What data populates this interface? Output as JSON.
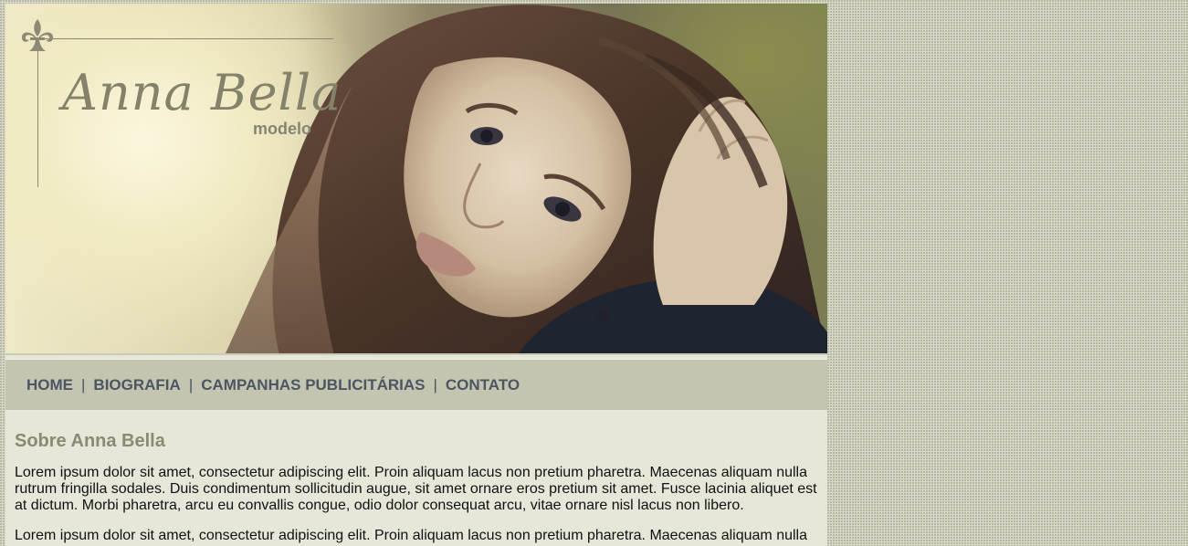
{
  "brand": {
    "name": "Anna Bella",
    "subtitle": "modelo"
  },
  "nav": {
    "items": [
      {
        "label": "HOME"
      },
      {
        "label": "BIOGRAFIA"
      },
      {
        "label": "CAMPANHAS PUBLICITÁRIAS"
      },
      {
        "label": "CONTATO"
      }
    ],
    "separator": "|"
  },
  "content": {
    "heading": "Sobre Anna Bella",
    "paragraphs": [
      "Lorem ipsum dolor sit amet, consectetur adipiscing elit. Proin aliquam lacus non pretium pharetra. Maecenas aliquam nulla rutrum fringilla sodales. Duis condimentum sollicitudin augue, sit amet ornare eros pretium sit amet. Fusce lacinia aliquet est at dictum. Morbi pharetra, arcu eu convallis congue, odio dolor consequat arcu, vitae ornare nisl lacus non libero.",
      "Lorem ipsum dolor sit amet, consectetur adipiscing elit. Proin aliquam lacus non pretium pharetra. Maecenas aliquam nulla"
    ]
  },
  "colors": {
    "page_bg": "#d8d9c8",
    "content_bg": "#e6e7d8",
    "nav_bg": "#c4c5b0",
    "nav_text": "#4b5563",
    "heading": "#8a8a72"
  },
  "icons": {
    "logo_ornament": "fleur-de-lis-icon"
  }
}
